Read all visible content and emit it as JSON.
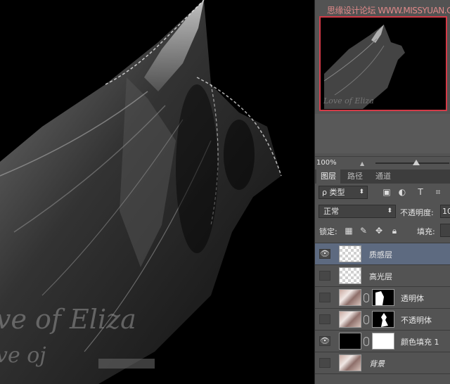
{
  "canvas": {
    "text_line1": "ve of Eliza",
    "text_line2": "ve oj"
  },
  "panel": {
    "watermark": "思缘设计论坛 WWW.MISSYUAN.COM",
    "navigator_text": "Love of Eliza",
    "zoom": {
      "value": "100%"
    },
    "tabs": [
      {
        "label": "图层",
        "active": true
      },
      {
        "label": "路径",
        "active": false
      },
      {
        "label": "通道",
        "active": false
      }
    ],
    "filter": {
      "type_label": "ρ 类型",
      "icons": [
        "image-filter-icon",
        "adjustment-filter-icon",
        "text-filter-icon",
        "shape-filter-icon"
      ]
    },
    "blend": {
      "mode": "正常",
      "opacity_label": "不透明度:",
      "opacity_value": "10"
    },
    "lock": {
      "label": "锁定:",
      "fill_label": "填充:"
    },
    "layers": [
      {
        "name": "质感层",
        "visible": true,
        "selected": true,
        "thumb": "checker",
        "mask": null
      },
      {
        "name": "高光层",
        "visible": false,
        "selected": false,
        "thumb": "checker",
        "mask": null
      },
      {
        "name": "透明体",
        "visible": false,
        "selected": false,
        "thumb": "photo",
        "mask": "black"
      },
      {
        "name": "不透明体",
        "visible": false,
        "selected": false,
        "thumb": "photo",
        "mask": "black"
      },
      {
        "name": "颜色填充 1",
        "visible": true,
        "selected": false,
        "thumb": "black",
        "mask": "white"
      },
      {
        "name": "背景",
        "visible": false,
        "selected": false,
        "thumb": "photo",
        "mask": null
      }
    ]
  }
}
